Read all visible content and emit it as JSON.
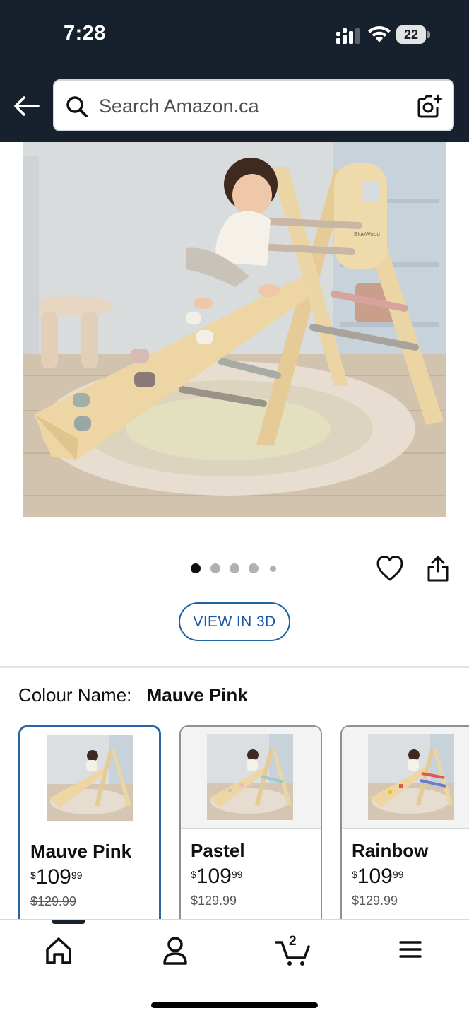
{
  "status_bar": {
    "time": "7:28",
    "battery": "22"
  },
  "search": {
    "placeholder": "Search Amazon.ca"
  },
  "product": {
    "image_brand_text": "BlueWood",
    "pager": {
      "count": 5,
      "active_index": 0
    },
    "view_3d_label": "VIEW IN 3D"
  },
  "colour": {
    "label": "Colour Name:",
    "selected": "Mauve Pink",
    "options": [
      {
        "name": "Mauve Pink",
        "currency": "$",
        "whole": "109",
        "fraction": "99",
        "was": "$129.99"
      },
      {
        "name": "Pastel",
        "currency": "$",
        "whole": "109",
        "fraction": "99",
        "was": "$129.99"
      },
      {
        "name": "Rainbow",
        "currency": "$",
        "whole": "109",
        "fraction": "99",
        "was": "$129.99"
      }
    ]
  },
  "bottom_nav": {
    "cart_count": "2",
    "items": [
      "home-icon",
      "account-icon",
      "cart-icon",
      "menu-icon"
    ]
  },
  "colors": {
    "header_bg": "#17202d",
    "link_blue": "#1b57a8",
    "selected_border": "#2a64a3"
  }
}
